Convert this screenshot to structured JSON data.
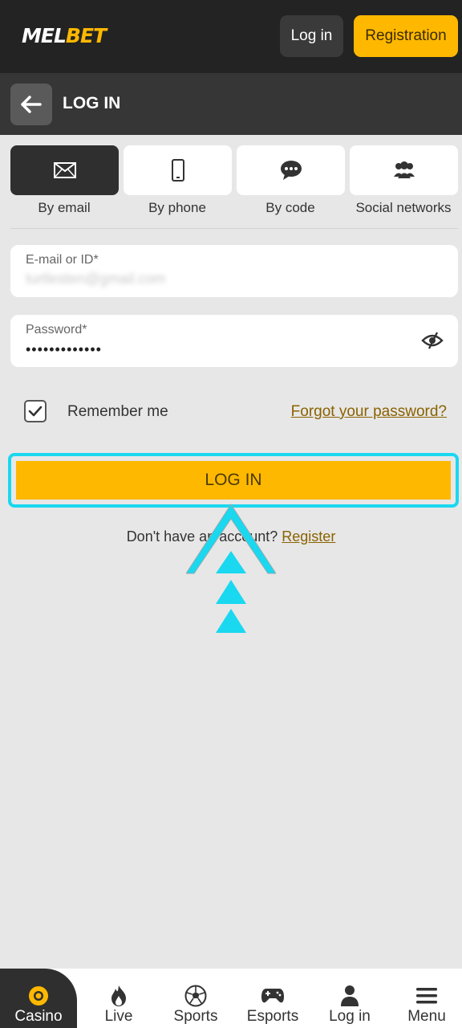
{
  "header": {
    "logo_left": "MEL",
    "logo_right": "BET",
    "login_label": "Log in",
    "registration_label": "Registration"
  },
  "subheader": {
    "title": "LOG IN"
  },
  "tabs": [
    {
      "label": "By email",
      "icon": "envelope-icon",
      "active": true
    },
    {
      "label": "By phone",
      "icon": "phone-icon",
      "active": false
    },
    {
      "label": "By code",
      "icon": "chat-icon",
      "active": false
    },
    {
      "label": "Social networks",
      "icon": "users-icon",
      "active": false
    }
  ],
  "form": {
    "email_label": "E-mail or ID*",
    "email_value": "turtlesten@gmail.com",
    "password_label": "Password*",
    "password_value": "•••••••••••••",
    "remember_label": "Remember me",
    "remember_checked": true,
    "forgot_label": "Forgot your password?",
    "login_button": "LOG IN",
    "no_account_text": "Don't have an account?",
    "register_link": "Register"
  },
  "bottom_nav": [
    {
      "label": "Casino",
      "icon": "casino-chip-icon",
      "active": true
    },
    {
      "label": "Live",
      "icon": "flame-icon",
      "active": false
    },
    {
      "label": "Sports",
      "icon": "soccer-ball-icon",
      "active": false
    },
    {
      "label": "Esports",
      "icon": "gamepad-icon",
      "active": false
    },
    {
      "label": "Log in",
      "icon": "user-icon",
      "active": false
    },
    {
      "label": "Menu",
      "icon": "hamburger-menu-icon",
      "active": false
    }
  ],
  "colors": {
    "accent": "#ffb800",
    "highlight": "#19d8f0",
    "dark": "#232323"
  }
}
